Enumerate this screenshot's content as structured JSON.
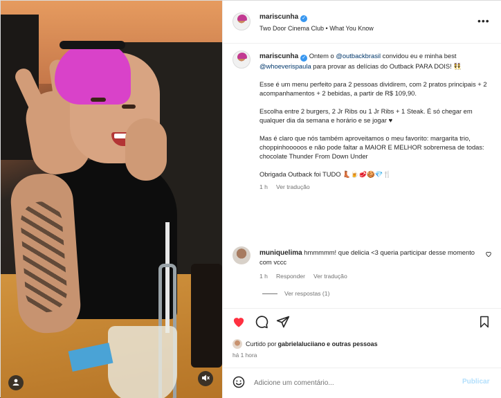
{
  "post": {
    "username": "mariscunha",
    "audio": "Two Door Cinema Club • What You Know"
  },
  "caption": {
    "username": "mariscunha",
    "p1_pre": "Ontem o ",
    "p1_mention1": "@outbackbrasil",
    "p1_mid": " convidou eu e minha best ",
    "p1_mention2": "@whoeverispaula",
    "p1_post": " para provar as delícias do Outback PARA DOIS! 👯",
    "p2": "Esse é um menu perfeito para 2 pessoas dividirem, com 2 pratos principais + 2 acompanhamentos + 2 bebidas, a partir de R$ 109,90.",
    "p3": "Escolha entre 2 burgers, 2 Jr Ribs ou 1 Jr Ribs + 1 Steak. É só chegar em qualquer dia da semana e horário e se jogar ♥",
    "p4": "Mas é claro que nós também aproveitamos o meu favorito: margarita trio, choppinhooooos e não pode faltar a MAIOR E MELHOR sobremesa de todas: chocolate Thunder From Down Under",
    "p5": "Obrigada Outback foi TUDO 👢🍺🥩🍪💎🍴",
    "time": "1 h",
    "translate": "Ver tradução"
  },
  "comment": {
    "username": "muniquelima",
    "text": "hmmmmm! que delicia <3 queria participar desse momento com vccc",
    "time": "1 h",
    "reply": "Responder",
    "translate": "Ver tradução",
    "view_replies": "Ver respostas (1)"
  },
  "likes": {
    "prefix": "Curtido por ",
    "user": "gabrielaluciiano",
    "suffix": " e outras pessoas"
  },
  "posted_time": "há 1 hora",
  "add_comment": {
    "placeholder": "Adicione um comentário...",
    "publish": "Publicar"
  },
  "colors": {
    "like_red": "#ff3040",
    "link_blue": "#00376b",
    "verified_blue": "#3897f0",
    "publish_disabled": "#b2dffc"
  }
}
